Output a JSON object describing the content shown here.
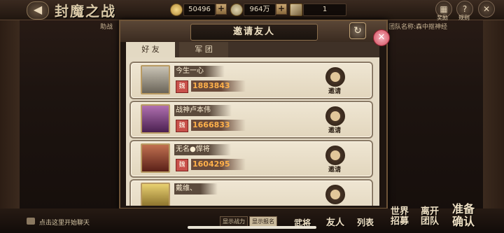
{
  "header": {
    "title": "封魔之战",
    "back_label": "◀",
    "gold": "50496",
    "coins": "964万",
    "stamina": "1",
    "plus_label": "+",
    "setting_label": "奖励",
    "rules_label": "规则",
    "left_subtitle": "助战",
    "team_name": "团队名称:森中抠神经"
  },
  "modal": {
    "title": "邀请友人",
    "refresh_label": "↻",
    "close_label": "✕",
    "tabs": [
      {
        "label": "好 友"
      },
      {
        "label": "军 团"
      }
    ],
    "invite_label": "邀请",
    "power_icon_label": "魏",
    "friends": [
      {
        "name": "今生一心",
        "power": "1883843",
        "avatar_color": "#8a8478"
      },
      {
        "name": "战神卢本伟",
        "power": "1666833",
        "avatar_color": "#7a3a7a"
      },
      {
        "name": "无名●悍将",
        "power": "1604295",
        "avatar_color": "#8a3a2e"
      },
      {
        "name": "戴维、",
        "power": "",
        "avatar_color": "#c8b050"
      }
    ]
  },
  "bottom": {
    "chat_hint": "点击这里开始聊天",
    "toggle_power": "显示战力",
    "toggle_other": "显示报名",
    "buttons": {
      "wujiang": "武将",
      "youren": "友人",
      "liebiao": "列表",
      "shijie_zhaomu": "世界招募",
      "likai_tuandui": "离开团队",
      "zhunbei_queren": "准备确认"
    }
  },
  "colors": {
    "accent_gold": "#ffb04a",
    "close_pink": "#d14858",
    "panel": "#e4dac5"
  }
}
